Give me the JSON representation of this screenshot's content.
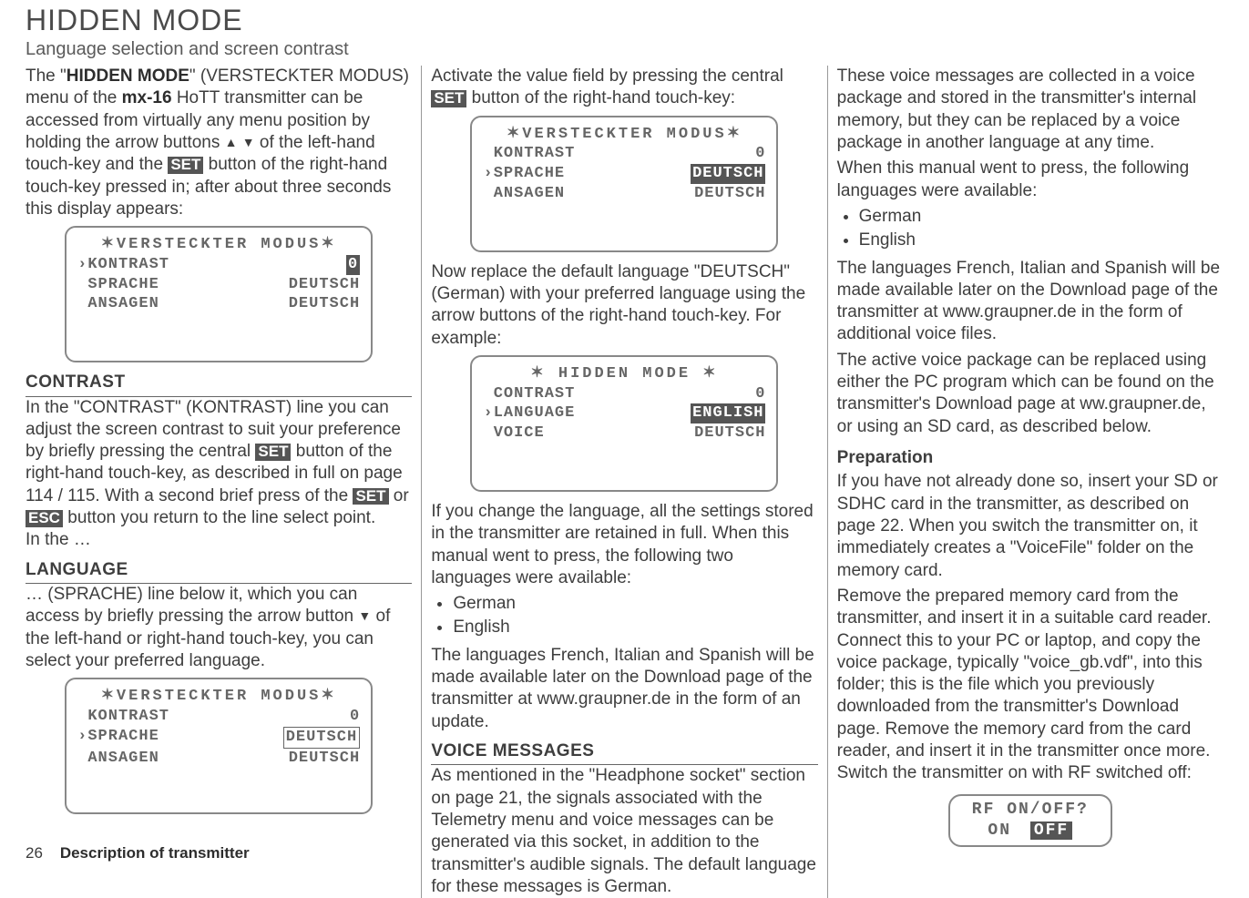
{
  "page": {
    "title": "HIDDEN MODE",
    "subtitle": "Language selection and screen contrast",
    "footer_num": "26",
    "footer_text": "Description of transmitter"
  },
  "keys": {
    "set": "SET",
    "esc": "ESC"
  },
  "arrows": {
    "up": "▲",
    "down": "▼"
  },
  "col1": {
    "intro1": "The \"",
    "hidden": "HIDDEN MODE",
    "intro2": "\" (VERSTECKTER MODUS) menu of the ",
    "mx16": "mx-16",
    "intro3": " HoTT transmitter can be accessed from virtually any menu position by holding the arrow buttons ",
    "intro4": " of the left-hand touch-key and the ",
    "intro5": " button of the right-hand touch-key pressed in; after about three seconds this display appears:",
    "contrast_h": "CONTRAST",
    "contrast_p1a": "In the \"CONTRAST\" (KONTRAST) line you can adjust the screen contrast to suit your preference by briefly pressing the central ",
    "contrast_p1b": " button of the right-hand touch-key, as described in full on page 114 / 115. With a second brief press of the ",
    "contrast_p1c": " or ",
    "contrast_p1d": " button you return to the line select point.",
    "contrast_p2": "In the …",
    "language_h": "LANGUAGE",
    "language_p1a": "… (SPRACHE) line below it, which you can access by briefly pressing the arrow button ",
    "language_p1b": " of the left-hand or right-hand touch-key, you can select your preferred language."
  },
  "col2": {
    "p1a": "Activate the value field by pressing the central ",
    "p1b": " button of the right-hand touch-key:",
    "p2": "Now replace the default language \"DEUTSCH\" (German) with your preferred language using the arrow buttons of the right-hand touch-key. For example:",
    "p3": "If you change the language, all the settings stored in the transmitter are retained in full. When this manual went to press, the following two languages were available:",
    "lang_list": [
      "German",
      "English"
    ],
    "p4": "The languages French, Italian and Spanish will be made available later on the Download page of the transmitter at www.graupner.de in the form of an update.",
    "voice_h": "VOICE MESSAGES",
    "voice_p": "As mentioned in the \"Headphone socket\" section on page 21, the signals associated with the Telemetry menu and voice messages can be generated via this socket, in addition to the transmitter's audible signals. The default language for these messages is German."
  },
  "col3": {
    "p1": "These voice messages are collected in a voice package and stored in the transmitter's internal memory, but they can be replaced by a voice package in another language at any time.",
    "p2": "When this manual went to press, the following languages were available:",
    "lang_list": [
      "German",
      "English"
    ],
    "p3": "The languages French, Italian and Spanish will be made available later on the Download page of the transmitter at www.graupner.de in the form of additional voice files.",
    "p4": "The active voice package can be replaced using either the PC program which can be found on the transmitter's Download page at ww.graupner.de, or using an SD card, as described below.",
    "prep_h": "Preparation",
    "prep_p1": "If you have not already done so, insert your SD or SDHC card in the transmitter, as described on page 22. When you switch the transmitter on, it immediately creates a \"VoiceFile\" folder on the memory card.",
    "prep_p2": "Remove the prepared memory card from the transmitter, and insert it in a suitable card reader. Connect this to your PC or laptop, and copy the voice package, typically \"voice_gb.vdf\", into this folder; this is the file which you previously downloaded from the transmitter's Download page. Remove the memory card from the card reader, and insert it in the transmitter once more. Switch the transmitter on with RF switched off:"
  },
  "screens": {
    "s1": {
      "title": "✶VERSTECKTER MODUS✶",
      "r1l": "KONTRAST",
      "r1r": "0",
      "r1sel": true,
      "r2l": "SPRACHE",
      "r2r": "DEUTSCH",
      "r3l": "ANSAGEN",
      "r3r": "DEUTSCH"
    },
    "s2": {
      "title": "✶VERSTECKTER MODUS✶",
      "r1l": "KONTRAST",
      "r1r": "0",
      "r2l": "SPRACHE",
      "r2r": "DEUTSCH",
      "r2sel": true,
      "r2box": true,
      "r3l": "ANSAGEN",
      "r3r": "DEUTSCH"
    },
    "s3": {
      "title": "✶VERSTECKTER MODUS✶",
      "r1l": "KONTRAST",
      "r1r": "0",
      "r2l": "SPRACHE",
      "r2r": "DEUTSCH",
      "r2sel": true,
      "r2hl": true,
      "r3l": "ANSAGEN",
      "r3r": "DEUTSCH"
    },
    "s4": {
      "title": "✶ HIDDEN MODE ✶",
      "r1l": "CONTRAST",
      "r1r": "0",
      "r2l": "LANGUAGE",
      "r2r": "ENGLISH",
      "r2sel": true,
      "r2hl": true,
      "r3l": "VOICE",
      "r3r": "DEUTSCH"
    }
  },
  "rfbox": {
    "line1": "RF ON/OFF?",
    "on": "ON",
    "off": "OFF"
  }
}
